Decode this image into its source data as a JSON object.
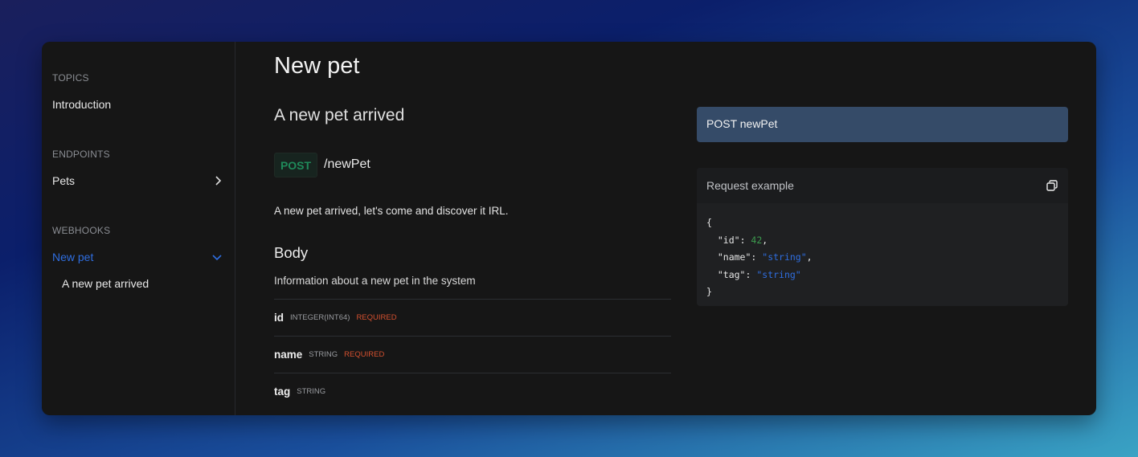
{
  "sidebar": {
    "sections": [
      {
        "title": "TOPICS",
        "items": [
          {
            "label": "Introduction"
          }
        ]
      },
      {
        "title": "ENDPOINTS",
        "items": [
          {
            "label": "Pets",
            "icon": "chevron-right-icon"
          }
        ]
      },
      {
        "title": "WEBHOOKS",
        "items": [
          {
            "label": "New pet",
            "icon": "chevron-down-icon",
            "active": true,
            "children": [
              {
                "label": "A new pet arrived"
              }
            ]
          }
        ]
      }
    ]
  },
  "main": {
    "title": "New pet",
    "subtitle": "A new pet arrived",
    "method": "POST",
    "path": "/newPet",
    "description": "A new pet arrived, let's come and discover it IRL.",
    "body_heading": "Body",
    "body_description": "Information about a new pet in the system",
    "fields": [
      {
        "name": "id",
        "type": "INTEGER(INT64)",
        "required": "REQUIRED"
      },
      {
        "name": "name",
        "type": "STRING",
        "required": "REQUIRED"
      },
      {
        "name": "tag",
        "type": "STRING"
      }
    ]
  },
  "right": {
    "endpoint_label": "POST newPet",
    "example_title": "Request example",
    "copy_icon": "copy-icon",
    "code": {
      "open": "{",
      "id_key": "\"id\"",
      "id_val": "42",
      "name_key": "\"name\"",
      "name_val": "\"string\"",
      "tag_key": "\"tag\"",
      "tag_val": "\"string\"",
      "close": "}"
    }
  },
  "colors": {
    "accent": "#2f6ee0",
    "post": "#1f8a5a",
    "required": "#d4502f",
    "endpoint_bg": "#354b68"
  }
}
